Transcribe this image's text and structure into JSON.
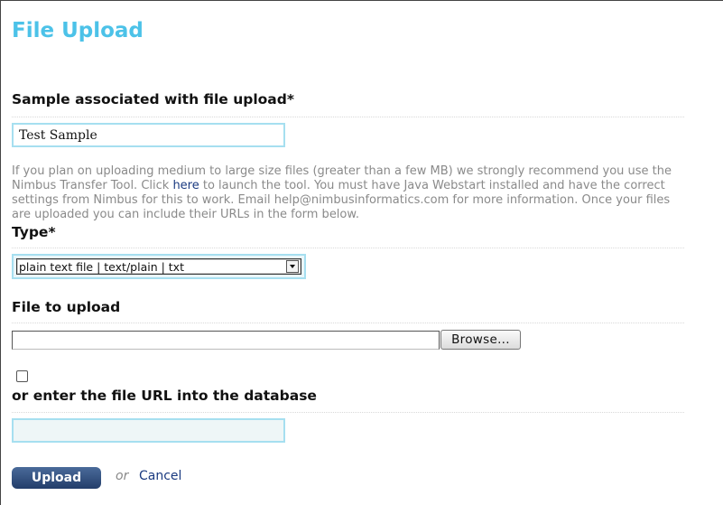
{
  "page": {
    "title": "File Upload"
  },
  "sample_section": {
    "label": "Sample associated with file upload*",
    "value": "Test Sample"
  },
  "hint": {
    "before_link": "If you plan on uploading medium to large size files (greater than a few MB) we strongly recommend you use the Nimbus Transfer Tool. Click ",
    "link": "here",
    "after_link": " to launch the tool. You must have Java Webstart installed and have the correct settings from Nimbus for this to work. Email help@nimbusinformatics.com for more information. Once your files are uploaded you can include their URLs in the form below."
  },
  "type_section": {
    "label": "Type*",
    "selected": "plain text file | text/plain | txt",
    "icon": "chevron-down-icon"
  },
  "file_section": {
    "label": "File to upload",
    "file_value": "",
    "browse_label": "Browse..."
  },
  "url_section": {
    "checkbox_checked": false,
    "label": "or enter the file URL into the database",
    "url_value": ""
  },
  "actions": {
    "upload_label": "Upload",
    "or_text": "or",
    "cancel_label": "Cancel"
  },
  "colors": {
    "title": "#4cc2e8",
    "link": "#1a3a80",
    "field_border": "#a6dff0",
    "button": "#233d6a"
  }
}
